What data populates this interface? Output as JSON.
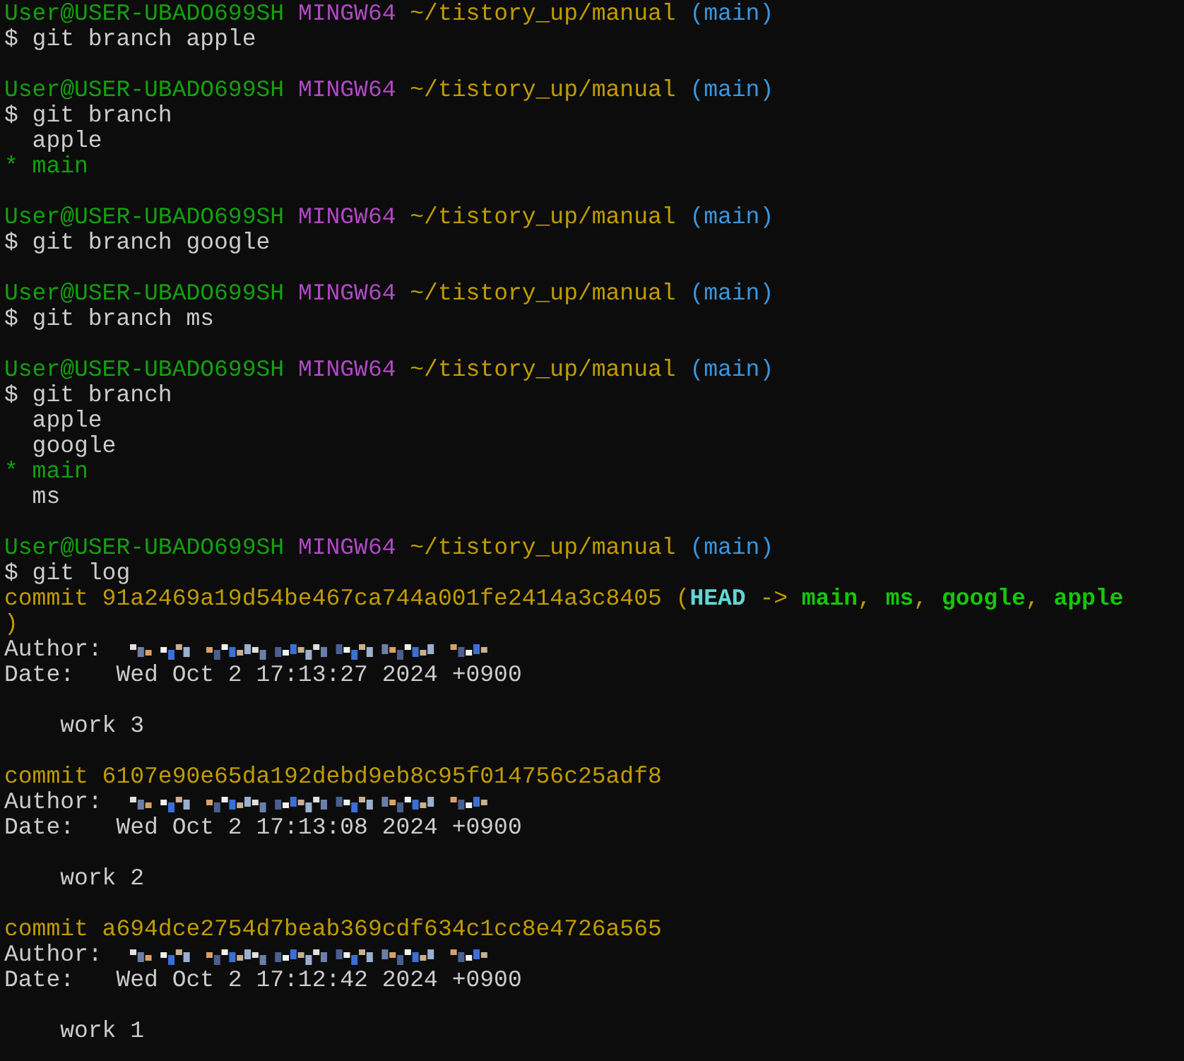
{
  "terminal": {
    "lines": [
      {
        "kind": "text",
        "segments": [
          {
            "kind": "user",
            "text": "User@USER-UBADO699SH "
          },
          {
            "kind": "host",
            "text": "MINGW64 "
          },
          {
            "kind": "path",
            "text": "~/tistory_up/manual "
          },
          {
            "kind": "branch",
            "text": "(main)"
          }
        ]
      },
      {
        "kind": "text",
        "segments": [
          {
            "kind": "plain",
            "text": "$ git branch apple"
          }
        ]
      },
      {
        "kind": "blank"
      },
      {
        "kind": "text",
        "segments": [
          {
            "kind": "user",
            "text": "User@USER-UBADO699SH "
          },
          {
            "kind": "host",
            "text": "MINGW64 "
          },
          {
            "kind": "path",
            "text": "~/tistory_up/manual "
          },
          {
            "kind": "branch",
            "text": "(main)"
          }
        ]
      },
      {
        "kind": "text",
        "segments": [
          {
            "kind": "plain",
            "text": "$ git branch"
          }
        ]
      },
      {
        "kind": "text",
        "segments": [
          {
            "kind": "plain",
            "text": "  apple"
          }
        ]
      },
      {
        "kind": "text",
        "segments": [
          {
            "kind": "current",
            "text": "* main"
          }
        ]
      },
      {
        "kind": "blank"
      },
      {
        "kind": "text",
        "segments": [
          {
            "kind": "user",
            "text": "User@USER-UBADO699SH "
          },
          {
            "kind": "host",
            "text": "MINGW64 "
          },
          {
            "kind": "path",
            "text": "~/tistory_up/manual "
          },
          {
            "kind": "branch",
            "text": "(main)"
          }
        ]
      },
      {
        "kind": "text",
        "segments": [
          {
            "kind": "plain",
            "text": "$ git branch google"
          }
        ]
      },
      {
        "kind": "blank"
      },
      {
        "kind": "text",
        "segments": [
          {
            "kind": "user",
            "text": "User@USER-UBADO699SH "
          },
          {
            "kind": "host",
            "text": "MINGW64 "
          },
          {
            "kind": "path",
            "text": "~/tistory_up/manual "
          },
          {
            "kind": "branch",
            "text": "(main)"
          }
        ]
      },
      {
        "kind": "text",
        "segments": [
          {
            "kind": "plain",
            "text": "$ git branch ms"
          }
        ]
      },
      {
        "kind": "blank"
      },
      {
        "kind": "text",
        "segments": [
          {
            "kind": "user",
            "text": "User@USER-UBADO699SH "
          },
          {
            "kind": "host",
            "text": "MINGW64 "
          },
          {
            "kind": "path",
            "text": "~/tistory_up/manual "
          },
          {
            "kind": "branch",
            "text": "(main)"
          }
        ]
      },
      {
        "kind": "text",
        "segments": [
          {
            "kind": "plain",
            "text": "$ git branch"
          }
        ]
      },
      {
        "kind": "text",
        "segments": [
          {
            "kind": "plain",
            "text": "  apple"
          }
        ]
      },
      {
        "kind": "text",
        "segments": [
          {
            "kind": "plain",
            "text": "  google"
          }
        ]
      },
      {
        "kind": "text",
        "segments": [
          {
            "kind": "current",
            "text": "* main"
          }
        ]
      },
      {
        "kind": "text",
        "segments": [
          {
            "kind": "plain",
            "text": "  ms"
          }
        ]
      },
      {
        "kind": "blank"
      },
      {
        "kind": "text",
        "segments": [
          {
            "kind": "user",
            "text": "User@USER-UBADO699SH "
          },
          {
            "kind": "host",
            "text": "MINGW64 "
          },
          {
            "kind": "path",
            "text": "~/tistory_up/manual "
          },
          {
            "kind": "branch",
            "text": "(main)"
          }
        ]
      },
      {
        "kind": "text",
        "segments": [
          {
            "kind": "plain",
            "text": "$ git log"
          }
        ]
      },
      {
        "kind": "text",
        "segments": [
          {
            "kind": "commit",
            "text": "commit 91a2469a19d54be467ca744a001fe2414a3c8405 ("
          },
          {
            "kind": "head",
            "text": "HEAD"
          },
          {
            "kind": "commit",
            "text": " -> "
          },
          {
            "kind": "ref",
            "text": "main"
          },
          {
            "kind": "commit",
            "text": ", "
          },
          {
            "kind": "ref",
            "text": "ms"
          },
          {
            "kind": "commit",
            "text": ", "
          },
          {
            "kind": "ref",
            "text": "google"
          },
          {
            "kind": "commit",
            "text": ", "
          },
          {
            "kind": "ref",
            "text": "apple"
          }
        ]
      },
      {
        "kind": "text",
        "segments": [
          {
            "kind": "commit",
            "text": ")"
          }
        ]
      },
      {
        "kind": "text",
        "segments": [
          {
            "kind": "plain",
            "text": "Author:"
          },
          {
            "kind": "redacted"
          }
        ]
      },
      {
        "kind": "text",
        "segments": [
          {
            "kind": "plain",
            "text": "Date:   Wed Oct 2 17:13:27 2024 +0900"
          }
        ]
      },
      {
        "kind": "blank"
      },
      {
        "kind": "text",
        "segments": [
          {
            "kind": "plain",
            "text": "    work 3"
          }
        ]
      },
      {
        "kind": "blank"
      },
      {
        "kind": "text",
        "segments": [
          {
            "kind": "commit",
            "text": "commit 6107e90e65da192debd9eb8c95f014756c25adf8"
          }
        ]
      },
      {
        "kind": "text",
        "segments": [
          {
            "kind": "plain",
            "text": "Author:"
          },
          {
            "kind": "redacted"
          }
        ]
      },
      {
        "kind": "text",
        "segments": [
          {
            "kind": "plain",
            "text": "Date:   Wed Oct 2 17:13:08 2024 +0900"
          }
        ]
      },
      {
        "kind": "blank"
      },
      {
        "kind": "text",
        "segments": [
          {
            "kind": "plain",
            "text": "    work 2"
          }
        ]
      },
      {
        "kind": "blank"
      },
      {
        "kind": "text",
        "segments": [
          {
            "kind": "commit",
            "text": "commit a694dce2754d7beab369cdf634c1cc8e4726a565"
          }
        ]
      },
      {
        "kind": "text",
        "segments": [
          {
            "kind": "plain",
            "text": "Author:"
          },
          {
            "kind": "redacted"
          }
        ]
      },
      {
        "kind": "text",
        "segments": [
          {
            "kind": "plain",
            "text": "Date:   Wed Oct 2 17:12:42 2024 +0900"
          }
        ]
      },
      {
        "kind": "blank"
      },
      {
        "kind": "text",
        "segments": [
          {
            "kind": "plain",
            "text": "    work 1"
          }
        ]
      }
    ]
  }
}
